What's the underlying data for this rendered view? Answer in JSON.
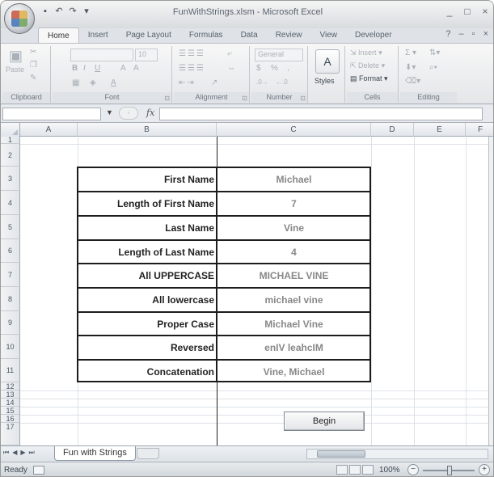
{
  "window": {
    "title": "FunWithStrings.xlsm - Microsoft Excel",
    "controls": [
      "_",
      "□",
      "×"
    ]
  },
  "ribbon": {
    "tabs": [
      "Home",
      "Insert",
      "Page Layout",
      "Formulas",
      "Data",
      "Review",
      "View",
      "Developer"
    ],
    "active_tab": "Home",
    "groups": {
      "clipboard": "Clipboard",
      "font": "Font",
      "alignment": "Alignment",
      "number": "Number",
      "styles": "Styles",
      "cells": "Cells",
      "editing": "Editing"
    },
    "paste_label": "Paste",
    "font_size": "10",
    "number_format": "General",
    "cells_insert": "Insert",
    "cells_delete": "Delete",
    "cells_format": "Format"
  },
  "formula_bar": {
    "fx": "fx",
    "value": ""
  },
  "grid": {
    "columns": [
      "A",
      "B",
      "C",
      "D",
      "E",
      "F"
    ],
    "rows": [
      "1",
      "2",
      "3",
      "4",
      "5",
      "6",
      "7",
      "8",
      "9",
      "10",
      "11",
      "12",
      "13",
      "14",
      "15",
      "16",
      "17"
    ]
  },
  "table": [
    {
      "label": "First Name",
      "value": "Michael"
    },
    {
      "label": "Length of First Name",
      "value": "7"
    },
    {
      "label": "Last Name",
      "value": "Vine"
    },
    {
      "label": "Length of Last Name",
      "value": "4"
    },
    {
      "label": "All UPPERCASE",
      "value": "MICHAEL VINE"
    },
    {
      "label": "All lowercase",
      "value": "michael vine"
    },
    {
      "label": "Proper Case",
      "value": "Michael Vine"
    },
    {
      "label": "Reversed",
      "value": "enIV leahcIM"
    },
    {
      "label": "Concatenation",
      "value": "Vine, Michael"
    }
  ],
  "begin_button": "Begin",
  "sheet_tab": "Fun with Strings",
  "status": {
    "ready": "Ready",
    "zoom": "100%"
  }
}
